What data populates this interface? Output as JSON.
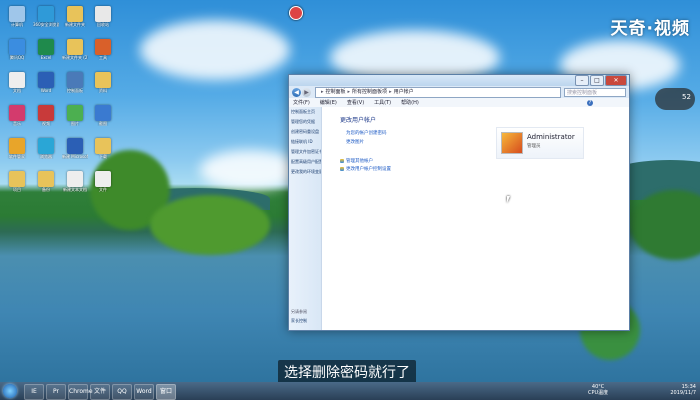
{
  "watermark": "天奇·视频",
  "desktop": {
    "icons": [
      {
        "label": "计算机",
        "color": "#9fc6ea"
      },
      {
        "label": "360安全浏览器",
        "color": "#2f9ad8"
      },
      {
        "label": "新建文件夹",
        "color": "#e8c35a"
      },
      {
        "label": "回收站",
        "color": "#e8e8e8"
      },
      {
        "label": "腾讯QQ",
        "color": "#3b8de0"
      },
      {
        "label": "Excel",
        "color": "#1f8a4c"
      },
      {
        "label": "新建文件夹 (2)",
        "color": "#e8c35a"
      },
      {
        "label": "工具",
        "color": "#d9602a"
      },
      {
        "label": "文档",
        "color": "#eeeeee"
      },
      {
        "label": "Word",
        "color": "#2b5fb5"
      },
      {
        "label": "控制面板",
        "color": "#4a7ab8"
      },
      {
        "label": "资料",
        "color": "#e8c35a"
      },
      {
        "label": "音乐",
        "color": "#d33b6d"
      },
      {
        "label": "视频",
        "color": "#c83a3a"
      },
      {
        "label": "图片",
        "color": "#4caf50"
      },
      {
        "label": "截图",
        "color": "#3a7ad0"
      },
      {
        "label": "软件管家",
        "color": "#e8a52a"
      },
      {
        "label": "浏览器",
        "color": "#2aa6d6"
      },
      {
        "label": "新建 Microsoft Word 文档",
        "color": "#2b5fb5"
      },
      {
        "label": "下载",
        "color": "#e8c35a"
      },
      {
        "label": "项目",
        "color": "#e8c35a"
      },
      {
        "label": "备份",
        "color": "#e8c35a"
      },
      {
        "label": "新建文本文档",
        "color": "#eeeeee"
      },
      {
        "label": "文件",
        "color": "#eeeeee"
      }
    ]
  },
  "window": {
    "title": "用户帐户",
    "address": [
      "控制面板",
      "所有控制面板项",
      "用户帐户"
    ],
    "search_placeholder": "搜索控制面板",
    "menu": [
      "文件(F)",
      "编辑(E)",
      "查看(V)",
      "工具(T)",
      "帮助(H)"
    ],
    "left_pane": [
      "控制面板主页",
      "管理您的凭据",
      "创建密码重设盘",
      "链接联机 ID",
      "管理文件加密证书",
      "配置高级用户配置文件属性",
      "更改我的环境变量"
    ],
    "left_bottom": [
      "另请参阅",
      "家长控制"
    ],
    "main_title": "更改用户帐户",
    "links": [
      "为您的帐户创建密码",
      "更改图片",
      "管理其他帐户",
      "更改用户帐户控制设置"
    ],
    "user": {
      "name": "Administrator",
      "role": "管理员"
    }
  },
  "subtitle": "选择删除密码就行了",
  "gadget": "52",
  "taskbar": {
    "apps": [
      "IE",
      "Pr",
      "Chrome",
      "文件",
      "QQ",
      "Word",
      "窗口"
    ],
    "tray_lang": "CH",
    "tray_temp": "40°C",
    "tray_cpu": "CPU温度",
    "time": "15:34",
    "date": "2019/11/7"
  }
}
